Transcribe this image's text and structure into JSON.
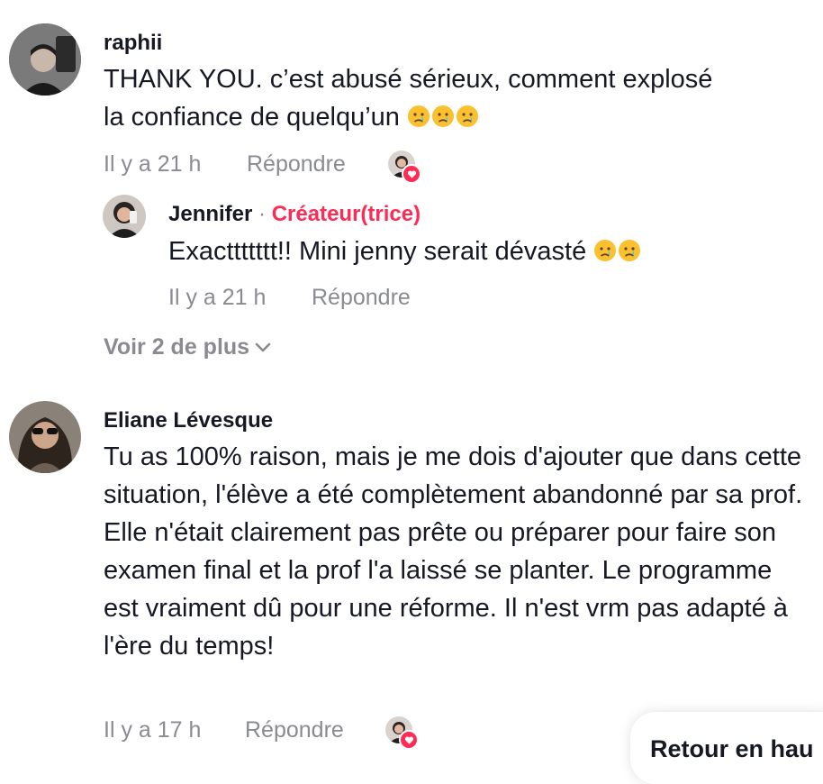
{
  "comments": [
    {
      "username": "raphii",
      "text": "THANK YOU. c’est abusé sérieux, comment explosé",
      "text_line2": "la confiance de quelqu’un",
      "emojis": [
        "crying-face-emoji",
        "crying-face-emoji",
        "crying-face-emoji"
      ],
      "time": "Il y a 21 h",
      "reply_label": "Répondre"
    },
    {
      "username": "Eliane Lévesque",
      "text": "Tu as 100% raison, mais je me dois d'ajouter que dans cette situation, l'élève a été complètement abandonné par sa prof. Elle n'était clairement pas prête ou préparer pour faire son examen final et la prof l'a laissé se planter. Le programme est vraiment dû pour une réforme. Il n'est vrm pas adapté à l'ère du temps!",
      "time": "Il y a 17 h",
      "reply_label": "Répondre"
    }
  ],
  "reply": {
    "username": "Jennifer",
    "separator": "·",
    "badge": "Créateur(trice)",
    "text": "Exacttttttt!! Mini jenny serait dévasté",
    "emojis": [
      "crying-face-emoji",
      "crying-face-emoji"
    ],
    "time": "Il y a 21 h",
    "reply_label": "Répondre"
  },
  "see_more": "Voir 2 de plus",
  "back_to_top": "Retour en hau",
  "colors": {
    "accent": "#fe2c55",
    "muted": "#8a8b91",
    "text": "#161823"
  }
}
